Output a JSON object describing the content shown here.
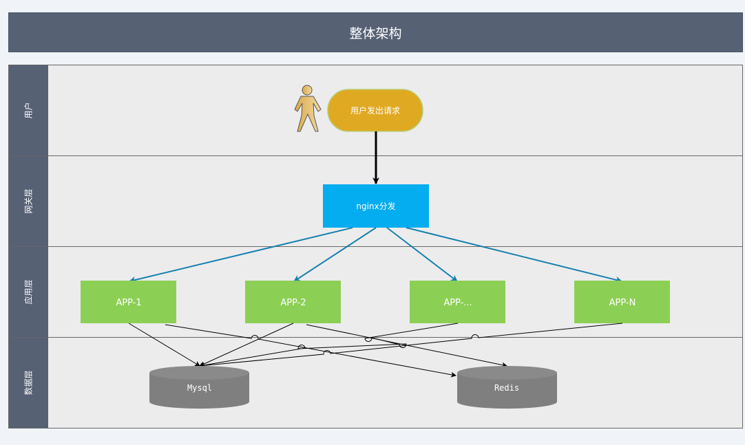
{
  "title": "整体架构",
  "lanes": [
    {
      "label": "用户"
    },
    {
      "label": "网关层"
    },
    {
      "label": "应用层"
    },
    {
      "label": "数据层"
    }
  ],
  "nodes": {
    "user_request": "用户发出请求",
    "nginx": "nginx分发",
    "app1": "APP-1",
    "app2": "APP-2",
    "app3": "APP-...",
    "appn": "APP-N",
    "mysql": "Mysql",
    "redis": "Redis"
  },
  "icons": {
    "user": "person-icon"
  },
  "colors": {
    "header": "#566174",
    "lane_bg": "#ececec",
    "user_request": "#e0a922",
    "nginx": "#04adef",
    "app": "#8ccf55",
    "database": "#7f7f7f",
    "gateway_arrow": "#1580ae"
  }
}
